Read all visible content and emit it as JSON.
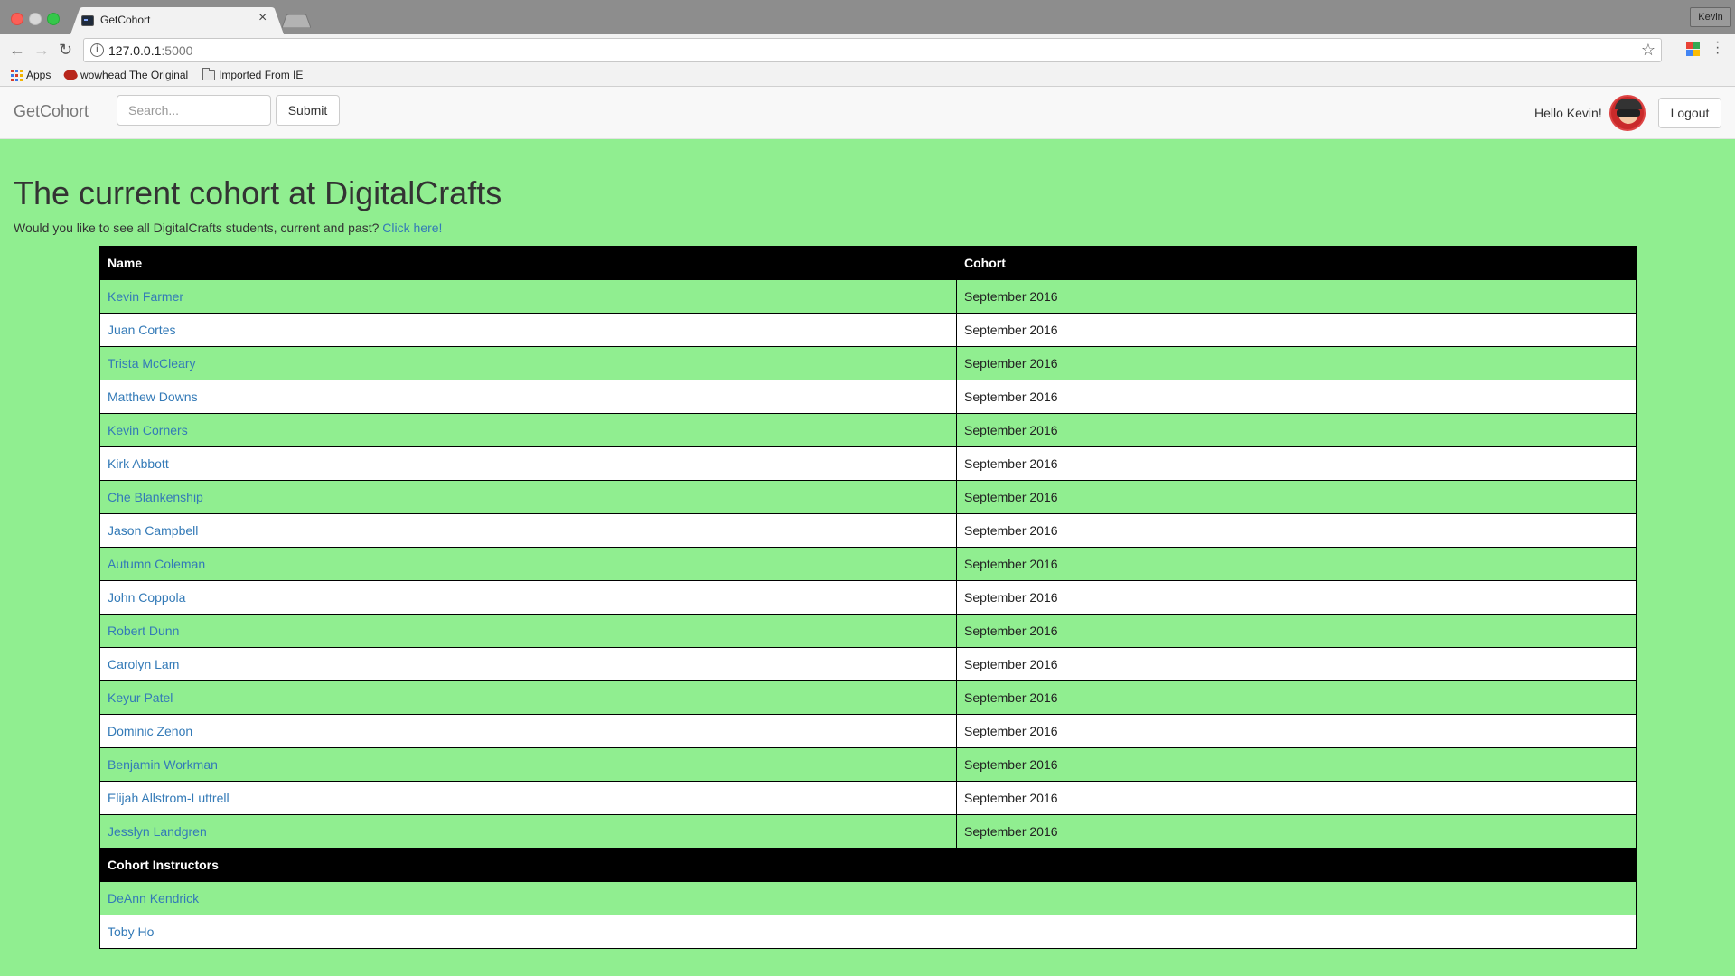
{
  "browser": {
    "tab_title": "GetCohort",
    "url_host": "127.0.0.1",
    "url_port": ":5000",
    "profile": "Kevin",
    "bookmarks": [
      {
        "label": "Apps"
      },
      {
        "label": "wowhead The Original"
      },
      {
        "label": "Imported From IE"
      }
    ]
  },
  "navbar": {
    "brand": "GetCohort",
    "search_placeholder": "Search...",
    "submit_label": "Submit",
    "greeting": "Hello Kevin!",
    "logout_label": "Logout"
  },
  "main": {
    "heading": "The current cohort at DigitalCrafts",
    "subtext": "Would you like to see all DigitalCrafts students, current and past?",
    "subtext_link": "Click here!"
  },
  "table": {
    "headers": [
      "Name",
      "Cohort"
    ],
    "students": [
      {
        "name": "Kevin Farmer",
        "cohort": "September 2016"
      },
      {
        "name": "Juan Cortes",
        "cohort": "September 2016"
      },
      {
        "name": "Trista McCleary",
        "cohort": "September 2016"
      },
      {
        "name": "Matthew Downs",
        "cohort": "September 2016"
      },
      {
        "name": "Kevin Corners",
        "cohort": "September 2016"
      },
      {
        "name": "Kirk Abbott",
        "cohort": "September 2016"
      },
      {
        "name": "Che Blankenship",
        "cohort": "September 2016"
      },
      {
        "name": "Jason Campbell",
        "cohort": "September 2016"
      },
      {
        "name": "Autumn Coleman",
        "cohort": "September 2016"
      },
      {
        "name": "John Coppola",
        "cohort": "September 2016"
      },
      {
        "name": "Robert Dunn",
        "cohort": "September 2016"
      },
      {
        "name": "Carolyn Lam",
        "cohort": "September 2016"
      },
      {
        "name": "Keyur Patel",
        "cohort": "September 2016"
      },
      {
        "name": "Dominic Zenon",
        "cohort": "September 2016"
      },
      {
        "name": "Benjamin Workman",
        "cohort": "September 2016"
      },
      {
        "name": "Elijah Allstrom-Luttrell",
        "cohort": "September 2016"
      },
      {
        "name": "Jesslyn Landgren",
        "cohort": "September 2016"
      }
    ],
    "instructors_header": "Cohort Instructors",
    "instructors": [
      "DeAnn Kendrick",
      "Toby Ho"
    ]
  },
  "colors": {
    "page_bg": "#90ee90",
    "link": "#337ab7",
    "header_bg": "#000000"
  }
}
